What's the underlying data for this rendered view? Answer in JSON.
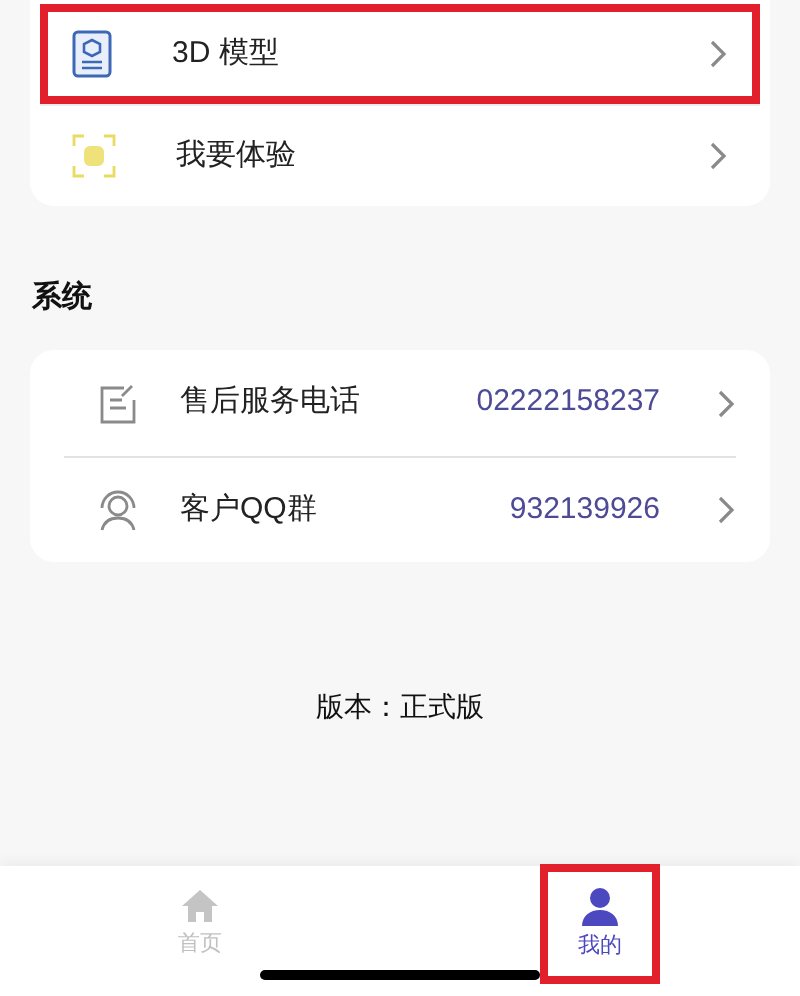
{
  "top_menu": [
    {
      "kind": "model",
      "label": "3D 模型",
      "highlighted": true
    },
    {
      "kind": "experience",
      "label": "我要体验",
      "highlighted": false
    }
  ],
  "section_title": "系统",
  "system_menu": [
    {
      "kind": "phone",
      "label": "售后服务电话",
      "value": "02222158237"
    },
    {
      "kind": "group",
      "label": "客户QQ群",
      "value": "932139926"
    }
  ],
  "version": "版本：正式版",
  "tabs": [
    {
      "kind": "home",
      "label": "首页",
      "selected": false,
      "highlighted": false
    },
    {
      "kind": "profile",
      "label": "我的",
      "selected": true,
      "highlighted": true
    }
  ]
}
